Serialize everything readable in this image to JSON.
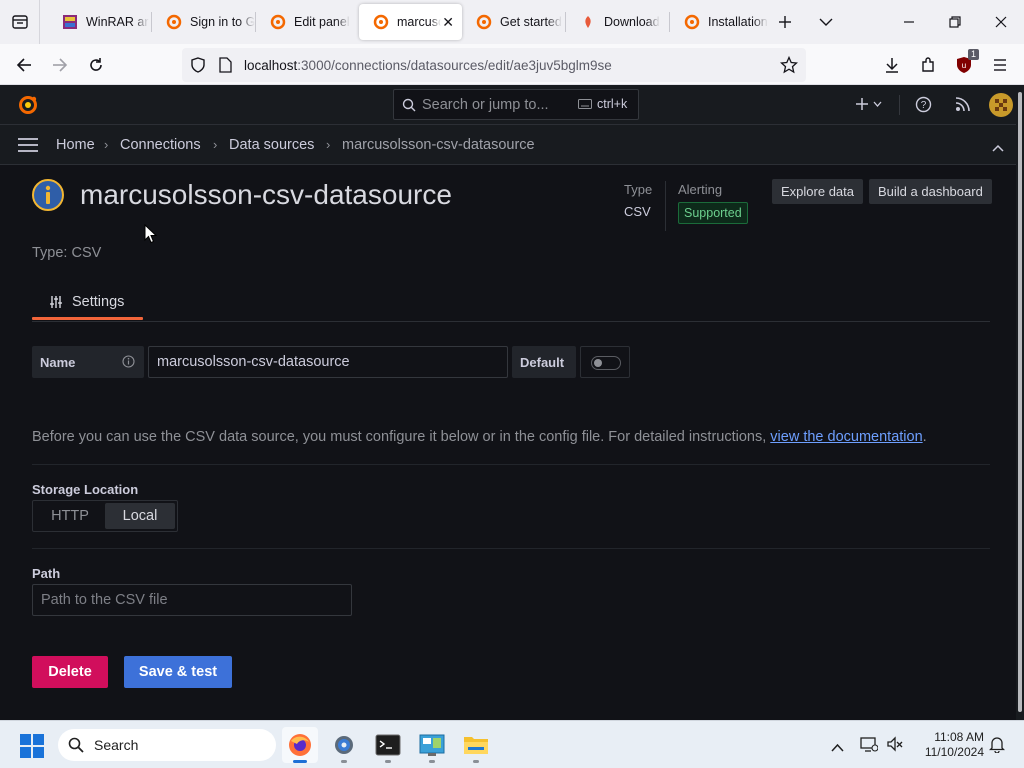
{
  "browser": {
    "tabs": [
      {
        "label": "WinRAR ar",
        "active": false
      },
      {
        "label": "Sign in to G",
        "active": false
      },
      {
        "label": "Edit panel",
        "active": false
      },
      {
        "label": "marcuso",
        "active": true
      },
      {
        "label": "Get started",
        "active": false
      },
      {
        "label": "Download",
        "active": false
      },
      {
        "label": "Installation",
        "active": false
      }
    ],
    "url_host": "localhost",
    "url_path": ":3000/connections/datasources/edit/ae3juv5bglm9se",
    "extensions_badge": "1"
  },
  "grafana": {
    "search_placeholder": "Search or jump to...",
    "search_shortcut": "ctrl+k",
    "breadcrumbs": [
      "Home",
      "Connections",
      "Data sources",
      "marcusolsson-csv-datasource"
    ],
    "datasource_title": "marcusolsson-csv-datasource",
    "type_line": "Type: CSV",
    "meta": {
      "type_label": "Type",
      "type_value": "CSV",
      "alerting_label": "Alerting",
      "alerting_value": "Supported"
    },
    "buttons": {
      "explore": "Explore data",
      "build_dashboard": "Build a dashboard",
      "delete": "Delete",
      "save_test": "Save & test"
    },
    "tabs": {
      "settings": "Settings"
    },
    "name_field": {
      "label": "Name",
      "value": "marcusolsson-csv-datasource",
      "default_label": "Default",
      "default_enabled": false
    },
    "help_text": "Before you can use the CSV data source, you must configure it below or in the config file. For detailed instructions, ",
    "help_link": "view the documentation",
    "help_end": ".",
    "storage": {
      "label": "Storage Location",
      "options": [
        "HTTP",
        "Local"
      ],
      "selected": "Local"
    },
    "path": {
      "label": "Path",
      "placeholder": "Path to the CSV file"
    }
  },
  "taskbar": {
    "search_placeholder": "Search",
    "time": "11:08 AM",
    "date": "11/10/2024"
  },
  "colors": {
    "grafana_bg": "#111217",
    "accent_orange": "#f2653a",
    "danger": "#d10e5c",
    "primary": "#3d71d9",
    "supported_green": "#6ccf8e",
    "link_blue": "#6e9fff"
  }
}
